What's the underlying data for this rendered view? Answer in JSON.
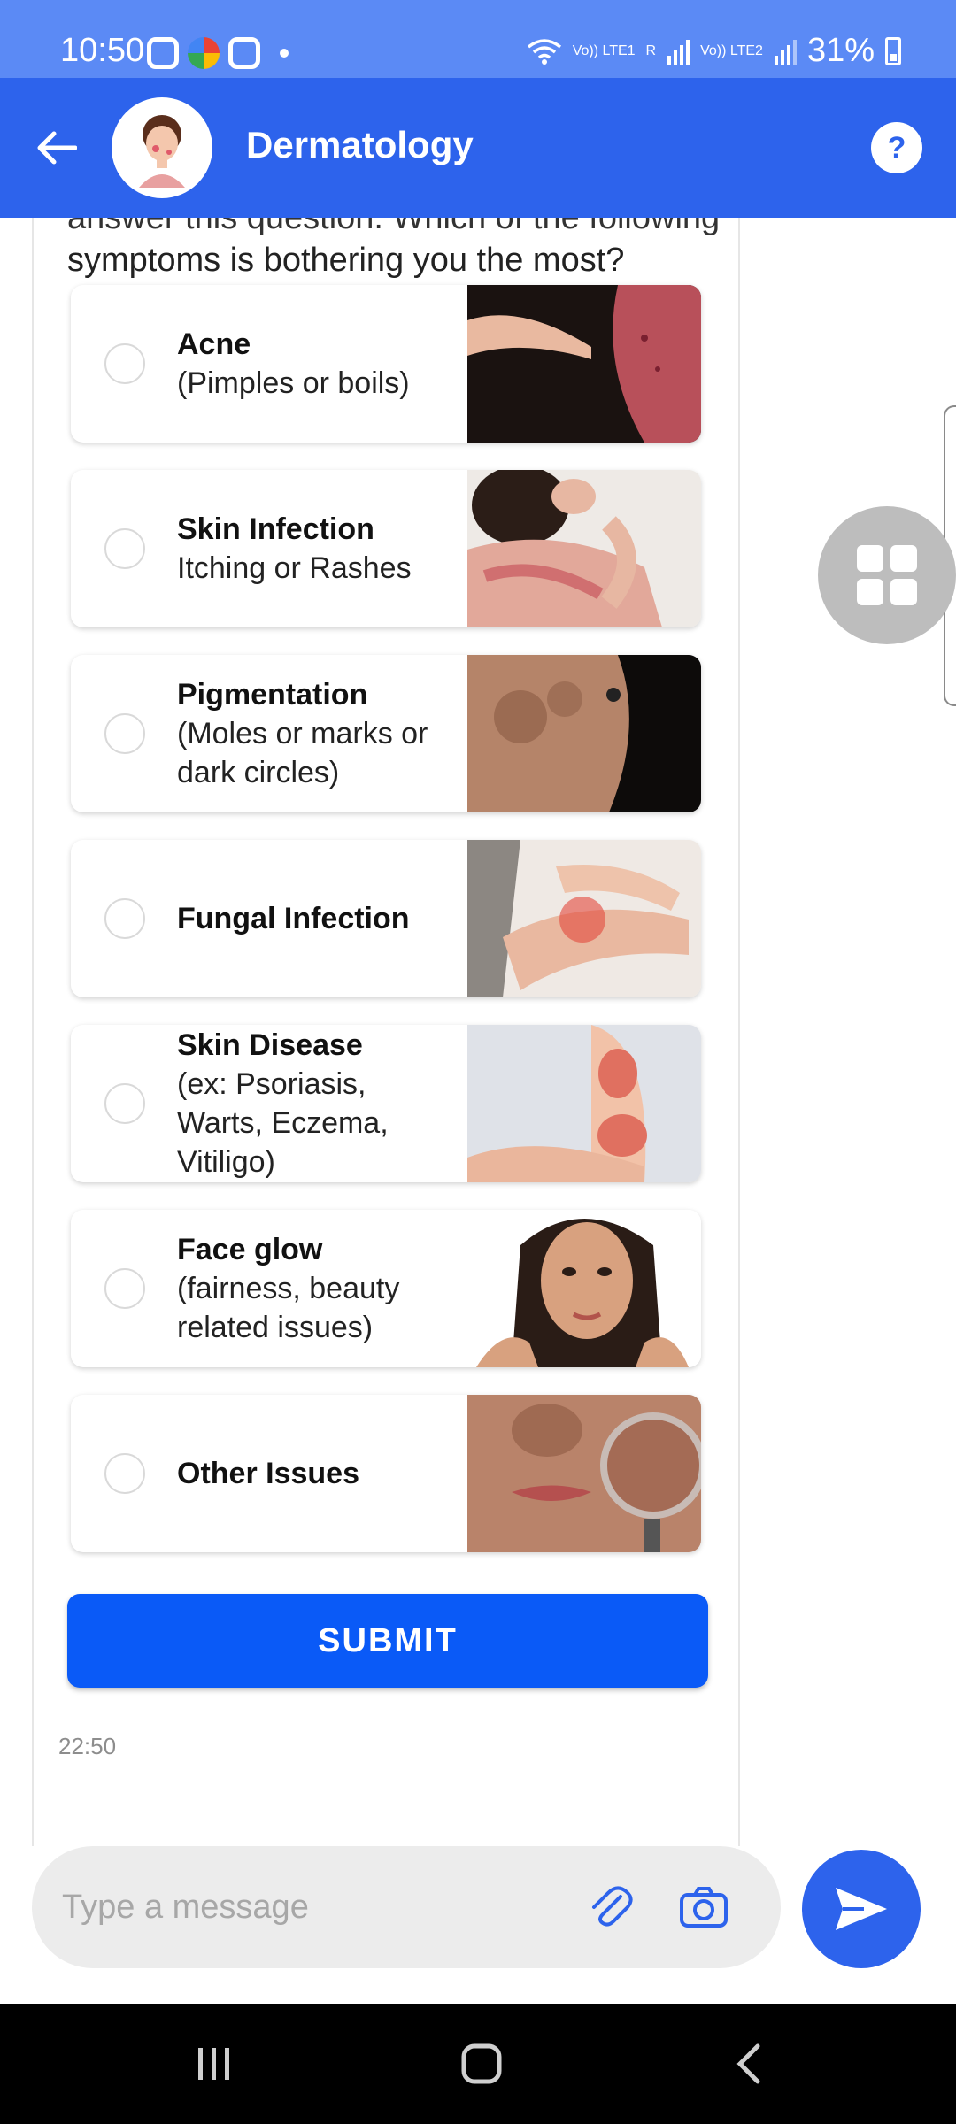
{
  "status_bar": {
    "time": "10:50",
    "network_label_1": "Vo)) LTE1",
    "network_label_2": "Vo)) LTE2",
    "roaming": "R",
    "battery": "31%"
  },
  "header": {
    "title": "Dermatology",
    "help_label": "?"
  },
  "chat": {
    "question_line_1": "answer this question. Which of the following",
    "question_line_2": "symptoms is bothering you the most?",
    "options": [
      {
        "title": "Acne",
        "subtitle": "(Pimples or boils)"
      },
      {
        "title": "Skin Infection",
        "subtitle": "Itching or Rashes"
      },
      {
        "title": "Pigmentation",
        "subtitle": "(Moles or marks or dark circles)"
      },
      {
        "title": "Fungal Infection",
        "subtitle": ""
      },
      {
        "title": "Skin Disease",
        "subtitle": "(ex: Psoriasis, Warts, Eczema, Vitiligo)"
      },
      {
        "title": "Face glow",
        "subtitle": "(fairness, beauty related issues)"
      },
      {
        "title": "Other Issues",
        "subtitle": ""
      }
    ],
    "submit_label": "SUBMIT",
    "timestamp": "22:50"
  },
  "composer": {
    "placeholder": "Type a message",
    "value": ""
  },
  "icons": {
    "back": "arrow-left-icon",
    "help": "question-icon",
    "attach": "paperclip-icon",
    "camera": "camera-icon",
    "send": "send-icon",
    "float": "grid-icon"
  },
  "colors": {
    "status_bar": "#5b8af5",
    "app_bar": "#2d63ec",
    "submit": "#0a5af7",
    "send": "#2d63ec"
  }
}
